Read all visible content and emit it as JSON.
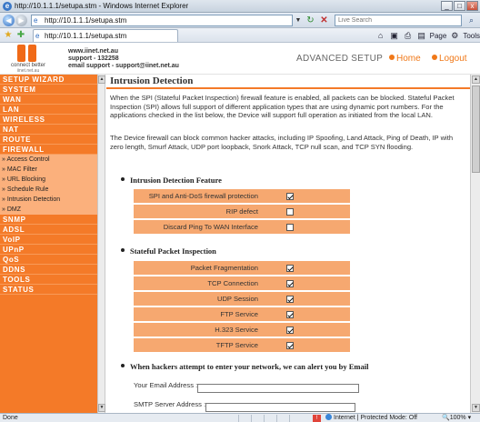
{
  "window": {
    "title": "http://10.1.1.1/setupa.stm - Windows Internet Explorer",
    "minimize": "_",
    "maximize": "□",
    "close": "x"
  },
  "browser": {
    "url": "http://10.1.1.1/setupa.stm",
    "search_placeholder": "Live Search",
    "tab_label": "http://10.1.1.1/setupa.stm",
    "page_menu": "Page",
    "tools_menu": "Tools"
  },
  "header": {
    "logo_tagline": "connect better",
    "logo_site": "iinet.net.au",
    "contact_line1": "www.iinet.net.au",
    "contact_line2": "support - 132258",
    "contact_line3": "email support - support@iinet.net.au",
    "section": "ADVANCED SETUP",
    "home_link": "Home",
    "logout_link": "Logout"
  },
  "sidebar": {
    "items": [
      {
        "label": "SETUP WIZARD"
      },
      {
        "label": "SYSTEM"
      },
      {
        "label": "WAN"
      },
      {
        "label": "LAN"
      },
      {
        "label": "WIRELESS"
      },
      {
        "label": "NAT"
      },
      {
        "label": "ROUTE"
      },
      {
        "label": "FIREWALL"
      },
      {
        "label": "SNMP"
      },
      {
        "label": "ADSL"
      },
      {
        "label": "VoIP"
      },
      {
        "label": "UPnP"
      },
      {
        "label": "QoS"
      },
      {
        "label": "DDNS"
      },
      {
        "label": "TOOLS"
      },
      {
        "label": "STATUS"
      }
    ],
    "firewall_sub": [
      {
        "label": "» Access Control"
      },
      {
        "label": "» MAC Filter"
      },
      {
        "label": "» URL Blocking"
      },
      {
        "label": "» Schedule Rule"
      },
      {
        "label": "» Intrusion Detection"
      },
      {
        "label": "» DMZ"
      }
    ]
  },
  "content": {
    "title": "Intrusion Detection",
    "para1": "When the SPI (Stateful Packet Inspection) firewall feature is enabled, all packets can be blocked. Stateful Packet Inspection (SPI) allows full support of different application types that are using dynamic port numbers. For the applications checked in the list below, the Device will support full operation as initiated from the local LAN.",
    "para2": "The Device firewall can block common hacker attacks, including IP Spoofing, Land Attack, Ping of Death, IP with zero length, Smurf Attack, UDP port loopback, Snork Attack, TCP null scan, and TCP SYN flooding.",
    "section1": "Intrusion Detection Feature",
    "features": [
      {
        "label": "SPI and Anti-DoS firewall protection",
        "checked": true
      },
      {
        "label": "RIP defect",
        "checked": false
      },
      {
        "label": "Discard Ping To WAN Interface",
        "checked": false
      }
    ],
    "section2": "Stateful Packet Inspection",
    "spi": [
      {
        "label": "Packet Fragmentation",
        "checked": true
      },
      {
        "label": "TCP Connection",
        "checked": true
      },
      {
        "label": "UDP Session",
        "checked": true
      },
      {
        "label": "FTP Service",
        "checked": true
      },
      {
        "label": "H.323 Service",
        "checked": true
      },
      {
        "label": "TFTP  Service",
        "checked": true
      }
    ],
    "section3": "When hackers attempt to enter your network, we can alert you by Email",
    "email_label": "Your Email Address :",
    "email_value": "",
    "smtp_label": "SMTP Server Address :",
    "smtp_value": ""
  },
  "status": {
    "text": "Done",
    "zone": "Internet | Protected Mode: Off",
    "zoom": "100%"
  },
  "colors": {
    "accent": "#f47a28",
    "row_fill": "#f6a870"
  }
}
